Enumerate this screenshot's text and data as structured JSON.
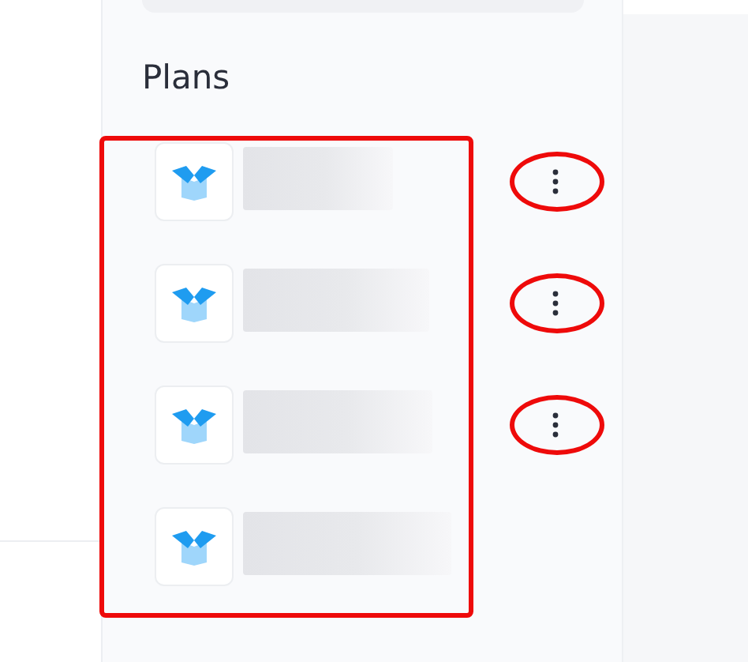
{
  "heading": "Plans",
  "annotations": {
    "list_frame": true,
    "menu_circles": true
  },
  "plans": [
    {
      "redacted": true,
      "has_menu": true
    },
    {
      "redacted": true,
      "has_menu": true
    },
    {
      "redacted": true,
      "has_menu": true
    },
    {
      "redacted": true,
      "has_menu": false
    }
  ]
}
